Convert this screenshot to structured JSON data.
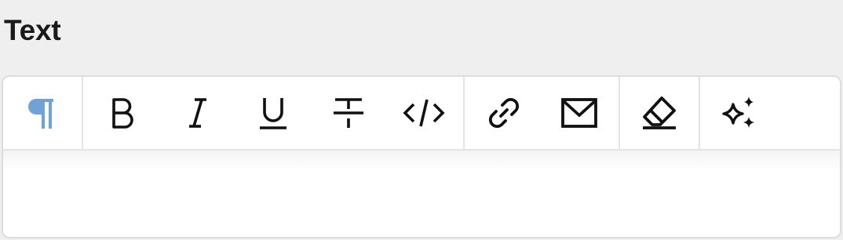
{
  "field": {
    "label": "Text"
  },
  "toolbar": {
    "groups": [
      {
        "tools": [
          {
            "name": "paragraph",
            "icon": "paragraph-icon",
            "active": true
          }
        ]
      },
      {
        "tools": [
          {
            "name": "bold",
            "icon": "bold-icon"
          },
          {
            "name": "italic",
            "icon": "italic-icon"
          },
          {
            "name": "underline",
            "icon": "underline-icon"
          },
          {
            "name": "strikethrough",
            "icon": "strikethrough-icon"
          },
          {
            "name": "code",
            "icon": "code-icon"
          }
        ]
      },
      {
        "tools": [
          {
            "name": "link",
            "icon": "link-icon"
          },
          {
            "name": "email",
            "icon": "envelope-icon"
          }
        ]
      },
      {
        "tools": [
          {
            "name": "clear-formatting",
            "icon": "eraser-icon"
          }
        ]
      },
      {
        "tools": [
          {
            "name": "ai-assist",
            "icon": "sparkles-icon"
          }
        ]
      }
    ]
  },
  "editor": {
    "content": ""
  },
  "colors": {
    "active_icon": "#6fa3d8",
    "icon": "#111111",
    "border": "#dcdcdc",
    "background": "#efefef"
  }
}
